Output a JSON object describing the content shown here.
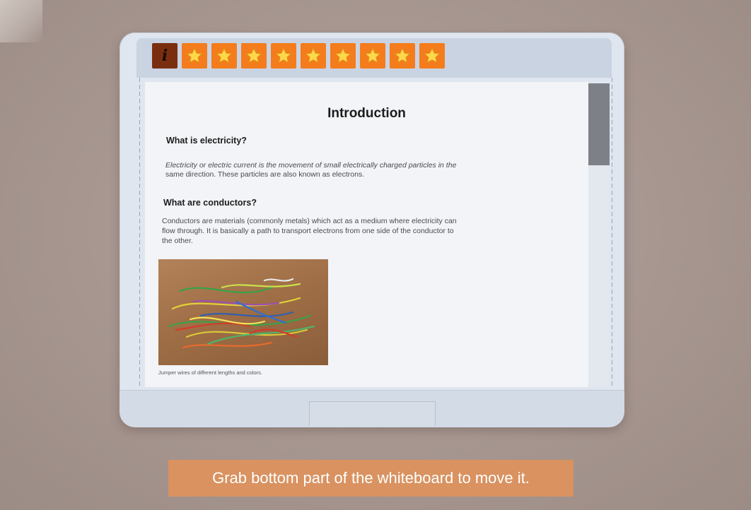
{
  "toolbar": {
    "info_label": "i",
    "stars": [
      "star",
      "star",
      "star",
      "star",
      "star",
      "star",
      "star",
      "star",
      "star"
    ]
  },
  "content": {
    "title": "Introduction",
    "section1_heading": "What is electricity?",
    "section1_line1": "Electricity or electric current is the movement of small electrically charged particles in the",
    "section1_line2": "same direction. These particles are also known as electrons.",
    "section2_heading": "What are conductors?",
    "section2_line1": "Conductors are materials (commonly metals) which act as a medium where electricity can",
    "section2_line2": "flow through. It is basically a path to transport electrons from one side of the conductor to",
    "section2_line3": "the other.",
    "image_caption": "Jumper wires of different lengths and colors."
  },
  "hint": {
    "text": "Grab bottom part of the whiteboard to move it."
  },
  "colors": {
    "star_button": "#f47c1c",
    "info_button": "#7a2e10",
    "hint_background": "#d99260",
    "scroll_thumb": "#7d8187"
  },
  "icons": {
    "info": "info-icon",
    "star": "star-icon"
  }
}
